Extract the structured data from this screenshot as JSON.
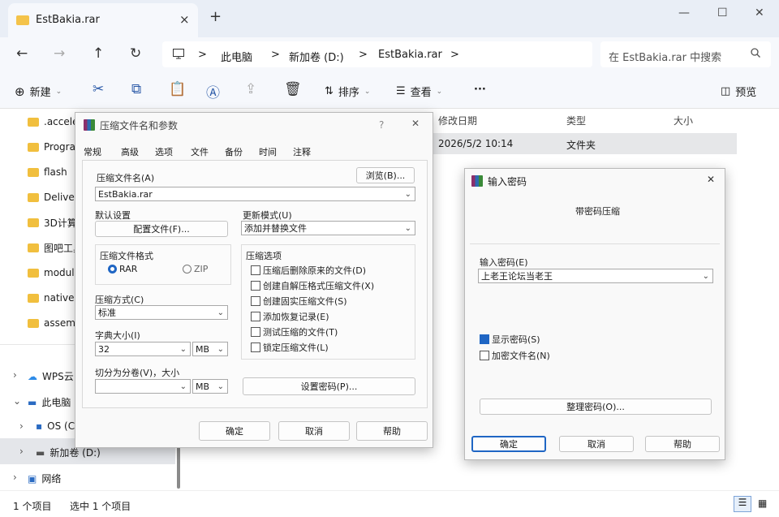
{
  "window": {
    "tab_title": "EstBakia.rar",
    "close_tab": "×",
    "new_tab": "+",
    "minimize": "—",
    "maximize": "☐",
    "close": "✕"
  },
  "nav_buttons": {
    "back": "←",
    "forward": "→",
    "up": "↑",
    "refresh": "↻"
  },
  "breadcrumb": [
    "此电脑",
    "新加卷 (D:)",
    "EstBakia.rar"
  ],
  "breadcrumb_sep": ">",
  "search": {
    "placeholder": "在 EstBakia.rar 中搜索"
  },
  "toolbar": {
    "new": "新建",
    "sort": "排序",
    "view": "查看",
    "more": "···",
    "preview": "预览"
  },
  "columns": {
    "date": "修改日期",
    "type": "类型",
    "size": "大小"
  },
  "row": {
    "date": "2026/5/2 10:14",
    "type": "文件夹"
  },
  "sidebar": {
    "items": [
      ".acceler",
      "Progra",
      "flash",
      "Deliver",
      "3D计算",
      "图吧工具",
      "modul",
      "native",
      "assemb"
    ],
    "tree": [
      "WPS云",
      "此电脑",
      "OS (C",
      "新加卷 (D:)",
      "网络"
    ]
  },
  "status": {
    "count": "1 个项目",
    "selected": "选中 1 个项目"
  },
  "archive_dialog": {
    "title": "压缩文件名和参数",
    "help": "?",
    "close": "✕",
    "tabs": [
      "常规",
      "高级",
      "选项",
      "文件",
      "备份",
      "时间",
      "注释"
    ],
    "archive_name_label": "压缩文件名(A)",
    "browse": "浏览(B)...",
    "archive_name_value": "EstBakia.rar",
    "default_settings": "默认设置",
    "profiles": "配置文件(F)...",
    "update_mode_label": "更新模式(U)",
    "update_mode_value": "添加并替换文件",
    "format_label": "压缩文件格式",
    "format_rar": "RAR",
    "format_zip": "ZIP",
    "options_label": "压缩选项",
    "options": [
      "压缩后删除原来的文件(D)",
      "创建自解压格式压缩文件(X)",
      "创建固实压缩文件(S)",
      "添加恢复记录(E)",
      "测试压缩的文件(T)",
      "锁定压缩文件(L)"
    ],
    "method_label": "压缩方式(C)",
    "method_value": "标准",
    "dict_label": "字典大小(I)",
    "dict_value": "32",
    "dict_unit": "MB",
    "split_label": "切分为分卷(V)，大小",
    "split_unit": "MB",
    "set_password": "设置密码(P)...",
    "ok": "确定",
    "cancel": "取消",
    "helpbtn": "帮助"
  },
  "password_dialog": {
    "title": "输入密码",
    "subtitle": "带密码压缩",
    "close": "✕",
    "enter_label": "输入密码(E)",
    "password_value": "上老王论坛当老王",
    "show_password": "显示密码(S)",
    "encrypt_names": "加密文件名(N)",
    "organize": "整理密码(O)...",
    "ok": "确定",
    "cancel": "取消",
    "help": "帮助"
  },
  "colors": {
    "accent": "#1f66c4",
    "folder": "#f4c34a"
  }
}
